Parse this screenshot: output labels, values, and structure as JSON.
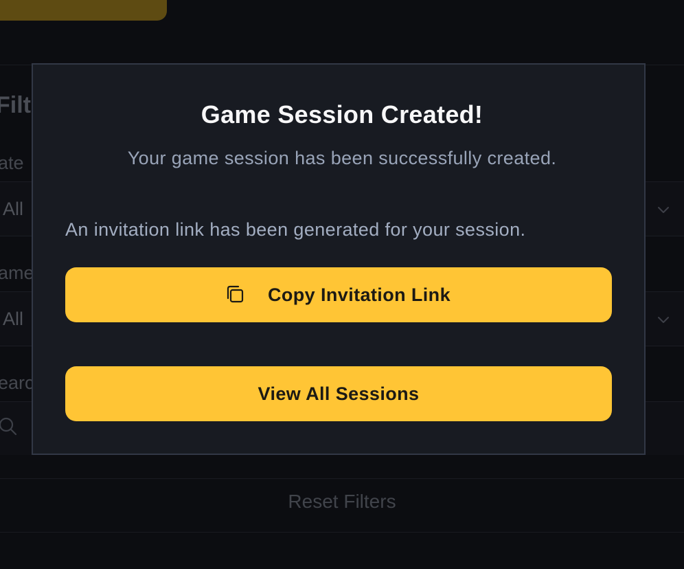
{
  "background": {
    "heading": "Filte",
    "date_label": "ate",
    "date_value": "All",
    "game_label": "ame",
    "game_value": "All",
    "search_label": "earc",
    "reset_label": "Reset Filters"
  },
  "modal": {
    "title": "Game Session Created!",
    "subtitle": "Your game session has been successfully created.",
    "invite_text": "An invitation link has been generated for your session.",
    "copy_button_label": "Copy Invitation Link",
    "view_button_label": "View All Sessions"
  },
  "icons": {
    "copy": "copy-icon",
    "chevron": "chevron-down-icon",
    "search": "search-icon"
  },
  "colors": {
    "accent": "#ffc535",
    "modal_bg": "#181b22",
    "page_bg": "#0c0d11"
  }
}
